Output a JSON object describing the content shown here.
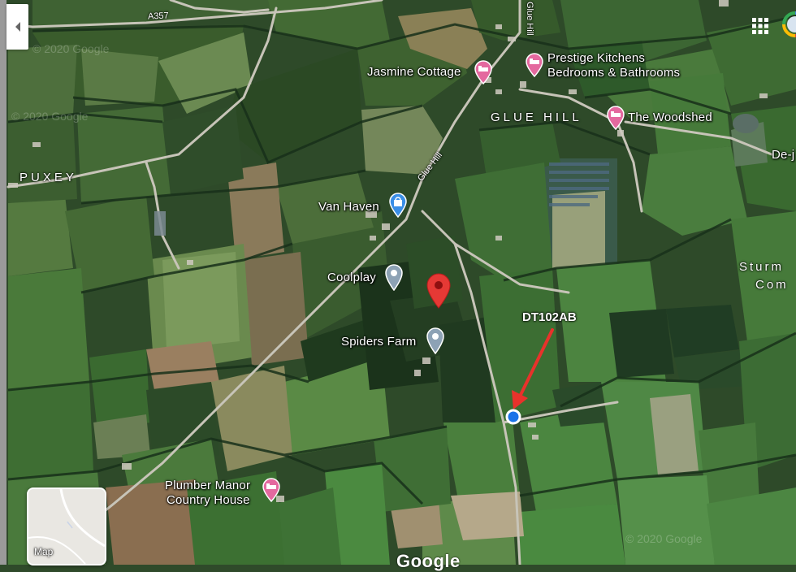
{
  "map": {
    "type": "satellite",
    "places": {
      "jasmine_cottage": "Jasmine Cottage",
      "prestige_kitchens_line1": "Prestige Kitchens",
      "prestige_kitchens_line2": "Bedrooms & Bathrooms",
      "the_woodshed": "The Woodshed",
      "van_haven": "Van Haven",
      "coolplay": "Coolplay",
      "spiders_farm": "Spiders Farm",
      "plumber_manor_line1": "Plumber Manor",
      "plumber_manor_line2": "Country House"
    },
    "areas": {
      "glue_hill": "GLUE HILL",
      "puxey": "PUXEY",
      "sturm_line1": "Sturm",
      "sturm_line2": "Com",
      "de_j": "De-j"
    },
    "roads": {
      "a357": "A357",
      "glue_hill_main": "Glue Hill",
      "glue_hill_north": "Glue Hill"
    },
    "annotation": {
      "label": "DT102AB",
      "color": "#e8322b"
    },
    "watermark": "© 2020 Google",
    "logo": "Google",
    "layer_toggle_label": "Map",
    "colors": {
      "pin_red": "#e53935",
      "lodging_pink": "#e4699f",
      "shop_blue": "#3a8ee6",
      "poi_gray": "#8da2b5",
      "location_blue": "#1a73e8"
    }
  }
}
